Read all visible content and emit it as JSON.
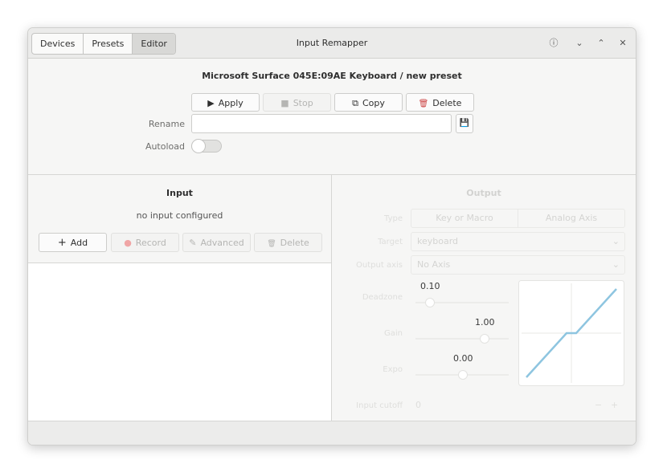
{
  "window": {
    "title": "Input Remapper",
    "tabs": [
      {
        "label": "Devices",
        "active": false
      },
      {
        "label": "Presets",
        "active": false
      },
      {
        "label": "Editor",
        "active": true
      }
    ],
    "controls": {
      "info": "ⓘ",
      "minimize": "⌄",
      "maximize": "⌃",
      "close": "✕"
    }
  },
  "editor": {
    "title": "Microsoft Surface 045E:09AE Keyboard  /  new preset",
    "buttons": {
      "apply": {
        "icon": "▶",
        "label": "Apply"
      },
      "stop": {
        "icon": "■",
        "label": "Stop"
      },
      "copy": {
        "icon": "⧉",
        "label": "Copy"
      },
      "delete": {
        "icon": "🗑",
        "label": "Delete"
      }
    },
    "rename_label": "Rename",
    "rename_value": "",
    "save_icon": "💾",
    "autoload_label": "Autoload",
    "autoload_on": false
  },
  "input_panel": {
    "title": "Input",
    "status": "no input configured",
    "buttons": {
      "add": {
        "icon": "+",
        "label": "Add"
      },
      "record": {
        "icon": "●",
        "label": "Record"
      },
      "advanced": {
        "icon": "✎",
        "label": "Advanced"
      },
      "delete": {
        "icon": "🗑",
        "label": "Delete"
      }
    }
  },
  "output_panel": {
    "title": "Output",
    "type_label": "Type",
    "type_options": [
      "Key or Macro",
      "Analog Axis"
    ],
    "target_label": "Target",
    "target_value": "keyboard",
    "output_axis_label": "Output axis",
    "output_axis_value": "No Axis",
    "deadzone_label": "Deadzone",
    "deadzone_value": "0.10",
    "gain_label": "Gain",
    "gain_value": "1.00",
    "expo_label": "Expo",
    "expo_value": "0.00",
    "input_cutoff_label": "Input cutoff",
    "input_cutoff_value": "0",
    "stepper": {
      "minus": "−",
      "plus": "+"
    },
    "accent_color": "#8ec5e0"
  }
}
